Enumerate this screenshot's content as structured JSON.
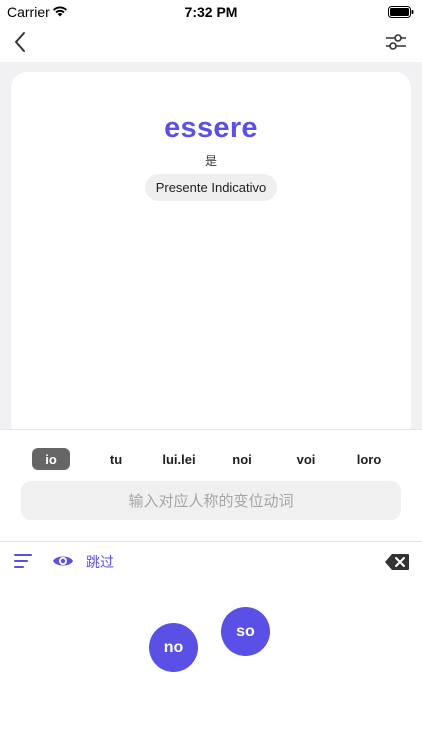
{
  "status_bar": {
    "carrier": "Carrier",
    "time": "7:32 PM"
  },
  "nav": {
    "back_icon": "chevron-left-icon",
    "filter_icon": "sliders-icon"
  },
  "card": {
    "verb": "essere",
    "meaning": "是",
    "tense": "Presente Indicativo"
  },
  "persons": [
    {
      "label": "io",
      "active": true
    },
    {
      "label": "tu",
      "active": false
    },
    {
      "label": "lui.lei",
      "active": false
    },
    {
      "label": "noi",
      "active": false
    },
    {
      "label": "voi",
      "active": false
    },
    {
      "label": "loro",
      "active": false
    }
  ],
  "answer": {
    "placeholder": "输入对应人称的变位动词",
    "value": ""
  },
  "toolbar": {
    "skip_label": "跳过",
    "menu_icon": "menu-lines-icon",
    "eye_icon": "eye-icon",
    "delete_icon": "backspace-icon"
  },
  "bubbles": [
    {
      "label": "no"
    },
    {
      "label": "so"
    }
  ],
  "colors": {
    "accent": "#5a50e6",
    "active_person_bg": "#666666",
    "card_bg": "#f1f1f3"
  }
}
